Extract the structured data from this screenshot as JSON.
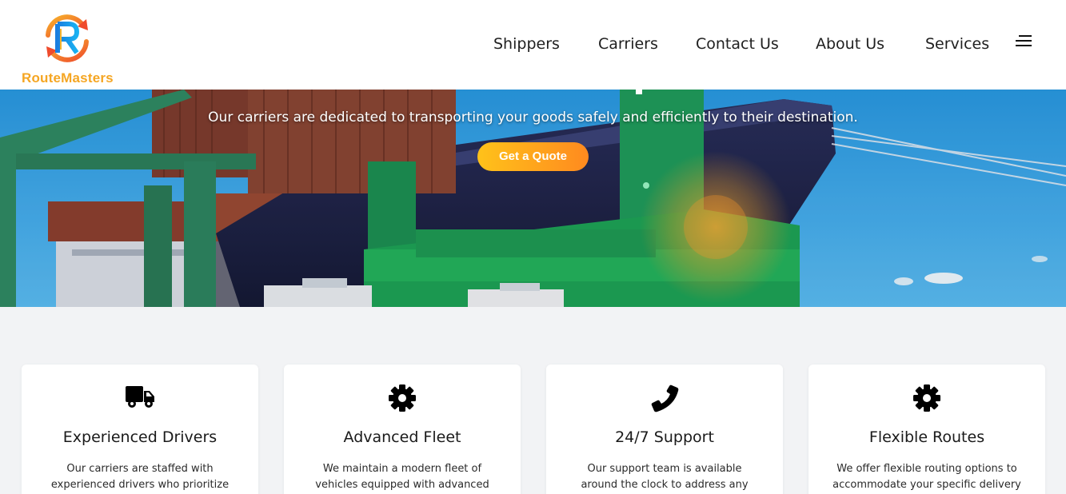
{
  "brand": {
    "name": "RouteMasters",
    "logo_icon": "route-masters-logo-icon",
    "accent": "#f5a623"
  },
  "nav": {
    "items": [
      {
        "label": "Shippers"
      },
      {
        "label": "Carriers"
      },
      {
        "label": "Contact Us"
      },
      {
        "label": "About Us"
      },
      {
        "label": "Services"
      }
    ],
    "menu_icon": "hamburger-menu-icon"
  },
  "hero": {
    "subtitle": "Our carriers are dedicated to transporting your goods safely and efficiently to their destination.",
    "cta_label": "Get a Quote",
    "cta_colors": [
      "#ffc21a",
      "#ff8a1f"
    ]
  },
  "features": [
    {
      "icon": "truck-icon",
      "title": "Experienced Drivers",
      "description": "Our carriers are staffed with experienced drivers who prioritize"
    },
    {
      "icon": "gear-icon",
      "title": "Advanced Fleet",
      "description": "We maintain a modern fleet of vehicles equipped with advanced technology for"
    },
    {
      "icon": "phone-icon",
      "title": "24/7 Support",
      "description": "Our support team is available around the clock to address any concerns and"
    },
    {
      "icon": "gear-icon",
      "title": "Flexible Routes",
      "description": "We offer flexible routing options to accommodate your specific delivery"
    }
  ]
}
